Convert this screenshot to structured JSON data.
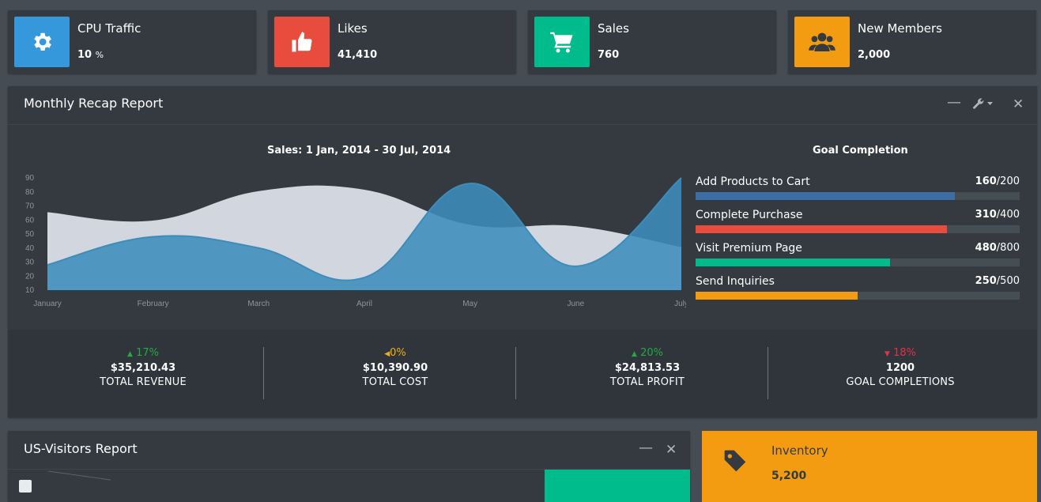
{
  "info_boxes": [
    {
      "label": "CPU Traffic",
      "value": "10",
      "unit": "%",
      "icon": "gear-icon",
      "color": "#3498db"
    },
    {
      "label": "Likes",
      "value": "41,410",
      "icon": "thumbs-up-icon",
      "color": "#e74c3c"
    },
    {
      "label": "Sales",
      "value": "760",
      "icon": "shopping-cart-icon",
      "color": "#00bc8c"
    },
    {
      "label": "New Members",
      "value": "2,000",
      "icon": "users-icon",
      "color": "#f39c12"
    }
  ],
  "recap": {
    "title": "Monthly Recap Report",
    "chart_title": "Sales: 1 Jan, 2014 - 30 Jul, 2014",
    "goal_title": "Goal Completion",
    "goals": [
      {
        "label": "Add Products to Cart",
        "done": "160",
        "total": "/200",
        "fraction": 0.8,
        "color": "#3c6ea5"
      },
      {
        "label": "Complete Purchase",
        "done": "310",
        "total": "/400",
        "fraction": 0.775,
        "color": "#e74c3c"
      },
      {
        "label": "Visit Premium Page",
        "done": "480",
        "total": "/800",
        "fraction": 0.6,
        "color": "#00bc8c"
      },
      {
        "label": "Send Inquiries",
        "done": "250",
        "total": "/500",
        "fraction": 0.5,
        "color": "#f39c12"
      }
    ],
    "stats": [
      {
        "pct": "17%",
        "arrow": "▲",
        "amount": "$35,210.43",
        "label": "TOTAL REVENUE",
        "color": "#28a745"
      },
      {
        "pct": "0%",
        "arrow": "◀",
        "amount": "$10,390.90",
        "label": "TOTAL COST",
        "color": "#f0ad1a"
      },
      {
        "pct": "20%",
        "arrow": "▲",
        "amount": "$24,813.53",
        "label": "TOTAL PROFIT",
        "color": "#28a745"
      },
      {
        "pct": "18%",
        "arrow": "▼",
        "amount": "1200",
        "label": "GOAL COMPLETIONS",
        "color": "#dc3545"
      }
    ]
  },
  "chart_data": {
    "type": "area",
    "title": "Sales: 1 Jan, 2014 - 30 Jul, 2014",
    "categories": [
      "January",
      "February",
      "March",
      "April",
      "May",
      "June",
      "July"
    ],
    "ylim": [
      10,
      90
    ],
    "yticks": [
      "10",
      "20",
      "30",
      "40",
      "50",
      "60",
      "70",
      "80",
      "90"
    ],
    "series": [
      {
        "values": [
          65,
          59,
          80,
          81,
          56,
          55,
          40
        ],
        "color": "#d2d6de"
      },
      {
        "values": [
          28,
          48,
          40,
          19,
          86,
          27,
          90
        ],
        "color": "#3c8dbc"
      }
    ],
    "grid": false
  },
  "visitors": {
    "title": "US-Visitors Report"
  },
  "inventory": {
    "label": "Inventory",
    "value": "5,200",
    "icon": "tag-icon",
    "color": "#f39c12"
  }
}
